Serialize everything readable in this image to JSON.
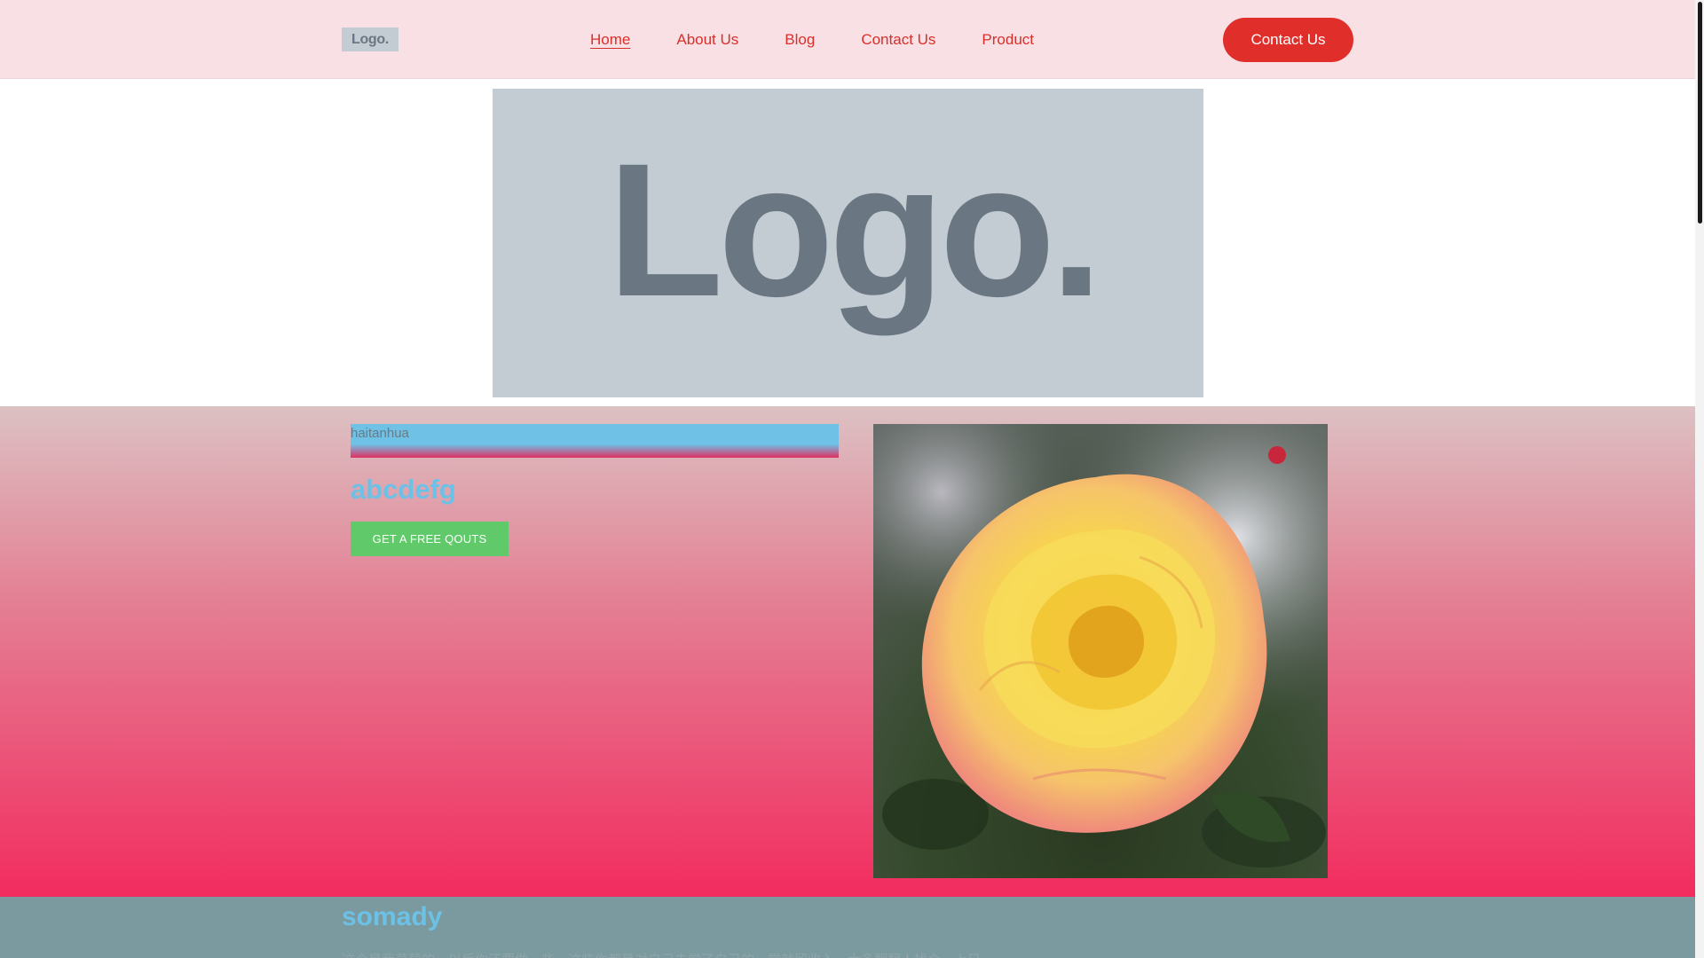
{
  "header": {
    "logo": "Logo.",
    "nav": [
      {
        "label": "Home",
        "active": true
      },
      {
        "label": "About Us",
        "active": false
      },
      {
        "label": "Blog",
        "active": false
      },
      {
        "label": "Contact Us",
        "active": false
      },
      {
        "label": "Product",
        "active": false
      }
    ],
    "cta_label": "Contact Us"
  },
  "banner": {
    "logo_text": "Logo."
  },
  "hero": {
    "eyebrow": "haitanhua",
    "title": "abcdefg",
    "button_label": "GET A FREE QOUTS",
    "image": "rose-photo"
  },
  "section": {
    "title": "somady",
    "text": "这个是我草莓的，以后你还要做一些，这些你都是对自己去学了自己的，觉就留收入，大多翻翻人找个一上只"
  },
  "colors": {
    "header_bg": "#f9e0e4",
    "accent_red": "#e02e2a",
    "placeholder_gray": "#c3cbd3",
    "title_blue": "#6cc1e6",
    "button_green": "#60ca6a",
    "band_bg": "#7b9aa0"
  }
}
